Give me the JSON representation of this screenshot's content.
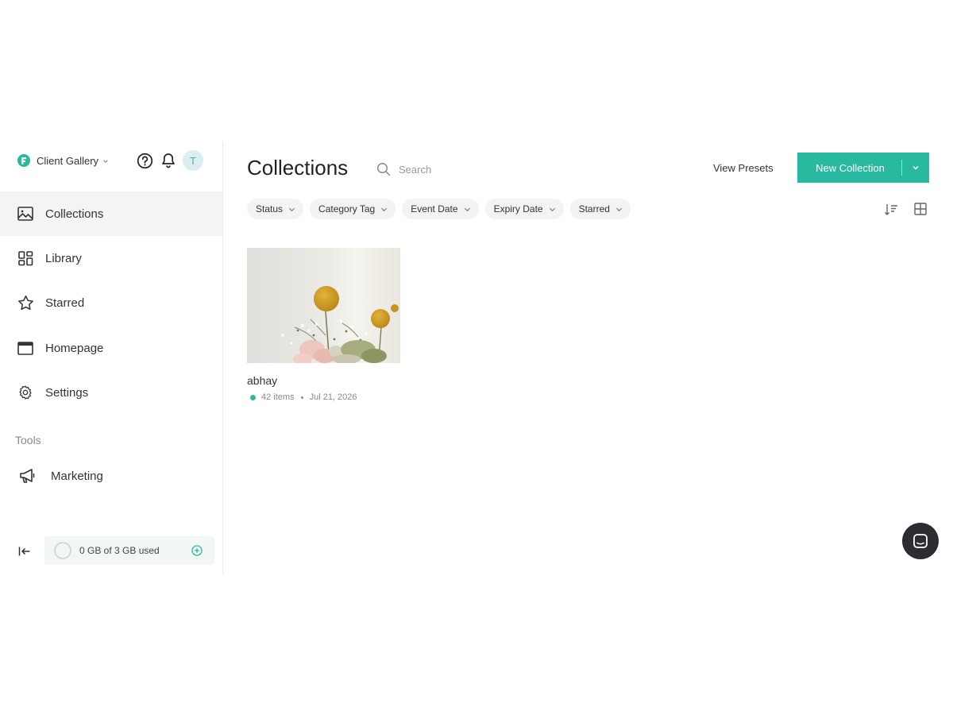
{
  "app": {
    "brand_name": "Client Gallery",
    "avatar_initial": "T",
    "accent_color": "#29b9a0"
  },
  "header_icons": [
    "help-icon",
    "bell-icon"
  ],
  "sidebar": {
    "items": [
      {
        "label": "Collections",
        "icon": "image-gallery-icon",
        "active": true
      },
      {
        "label": "Library",
        "icon": "library-grid-icon",
        "active": false
      },
      {
        "label": "Starred",
        "icon": "star-icon",
        "active": false
      },
      {
        "label": "Homepage",
        "icon": "browser-window-icon",
        "active": false
      },
      {
        "label": "Settings",
        "icon": "gear-icon",
        "active": false
      }
    ],
    "tools_title": "Tools",
    "tools": [
      {
        "label": "Marketing",
        "icon": "megaphone-icon"
      }
    ],
    "storage_text": "0 GB of 3 GB used"
  },
  "main": {
    "title": "Collections",
    "search_placeholder": "Search",
    "view_presets_label": "View Presets",
    "new_collection_label": "New Collection",
    "filters": [
      "Status",
      "Category Tag",
      "Event Date",
      "Expiry Date",
      "Starred"
    ]
  },
  "collections": [
    {
      "name": "abhay",
      "items": "42 items",
      "date": "Jul 21, 2026",
      "status_color": "#29b9a0"
    }
  ]
}
